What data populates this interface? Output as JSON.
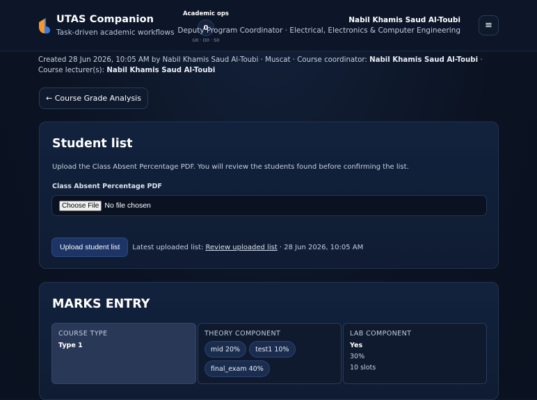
{
  "app": {
    "title": "UTAS Companion",
    "subtitle": "Task-driven academic workflows"
  },
  "ops": {
    "label": "Academic ops",
    "count": "0",
    "breakdown": "U0 · O0 · S0"
  },
  "user": {
    "name": "Nabil Khamis Saud Al-Toubi",
    "role": "Deputy Program Coordinator · Electrical, Electronics & Computer Engineering"
  },
  "menu": {
    "icon": "≡"
  },
  "meta": {
    "created": "Created 28 Jun 2026, 10:05 AM by Nabil Khamis Saud Al-Toubi · Muscat · Course coordinator: ",
    "coordinator": "Nabil Khamis Saud Al-Toubi",
    "lecturer_prefix": " · Course lecturer(s): ",
    "lecturer": "Nabil Khamis Saud Al-Toubi"
  },
  "back": {
    "label": "← Course Grade Analysis"
  },
  "student_list": {
    "title": "Student list",
    "description": "Upload the Class Absent Percentage PDF. You will review the students found before confirming the list.",
    "field_label": "Class Absent Percentage PDF",
    "choose_label": "Choose File",
    "no_file": "No file chosen",
    "upload_label": "Upload student list",
    "latest_prefix": "Latest uploaded list: ",
    "latest_link": "Review uploaded list",
    "latest_suffix": " · 28 Jun 2026, 10:05 AM"
  },
  "marks_entry": {
    "title": "MARKS ENTRY",
    "course_type": {
      "head": "COURSE TYPE",
      "value": "Type 1"
    },
    "theory": {
      "head": "THEORY COMPONENT",
      "chips": [
        "mid 20%",
        "test1 10%",
        "final_exam 40%"
      ]
    },
    "lab": {
      "head": "LAB COMPONENT",
      "enabled": "Yes",
      "weight": "30%",
      "slots": "10 slots"
    }
  },
  "colors": {
    "background": "#0c1526",
    "card": "#12223d",
    "accent": "#1c3566",
    "logo_orange": "#f59a2a",
    "logo_blue": "#3b7be0"
  }
}
